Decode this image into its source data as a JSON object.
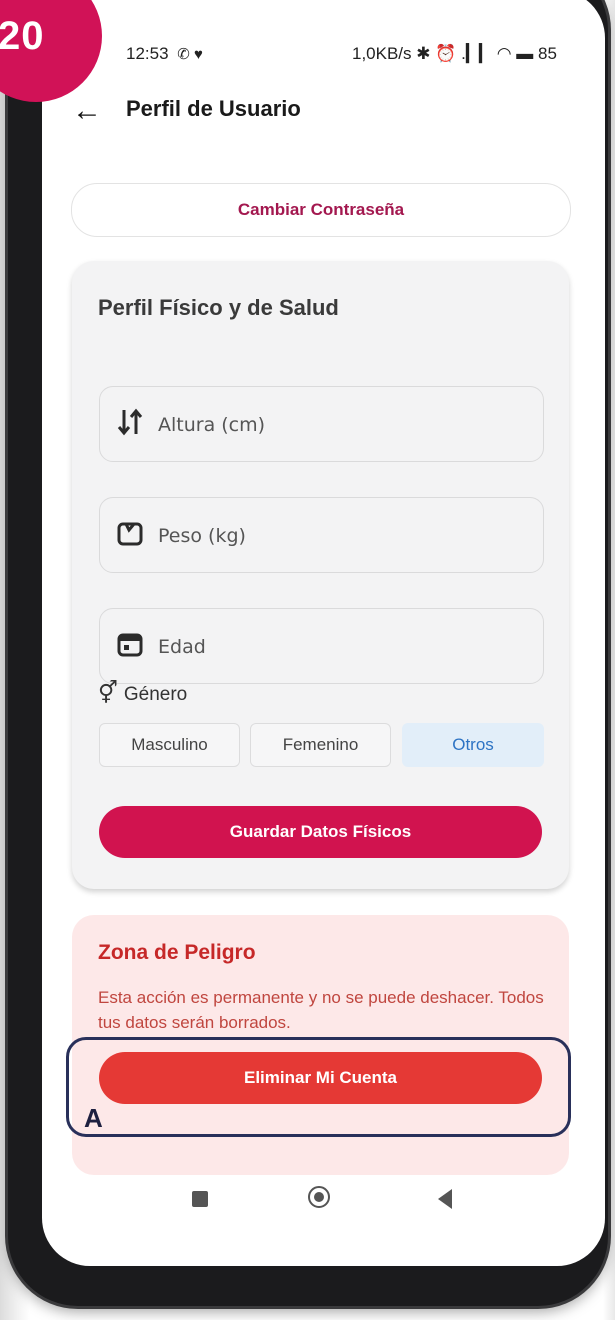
{
  "badge": {
    "number": "20"
  },
  "status_bar": {
    "time": "12:53",
    "left_icons": "✆ ♥",
    "right_text": "1,0KB/s ✱ ⏰ .▎▎ ◠ ▬ 85"
  },
  "header": {
    "back_icon": "arrow-left-icon",
    "title": "Perfil de Usuario"
  },
  "change_password": {
    "label": "Cambiar Contraseña"
  },
  "physical_profile": {
    "title": "Perfil Físico y de Salud",
    "fields": [
      {
        "icon": "height-arrows-icon",
        "placeholder": "Altura (cm)"
      },
      {
        "icon": "weight-icon",
        "placeholder": "Peso (kg)"
      },
      {
        "icon": "calendar-icon",
        "placeholder": "Edad"
      }
    ],
    "gender": {
      "label": "Género",
      "icon": "gender-icon",
      "options": [
        "Masculino",
        "Femenino",
        "Otros"
      ],
      "selected": "Otros"
    },
    "save_label": "Guardar Datos Físicos"
  },
  "danger_zone": {
    "title": "Zona de Peligro",
    "text": "Esta acción es permanente y no se puede deshacer. Todos tus datos serán borrados.",
    "delete_label": "Eliminar Mi Cuenta"
  },
  "annotation": {
    "label": "A"
  },
  "colors": {
    "accent": "#d1134f",
    "danger": "#e53935",
    "selected_option": "#2d73c4"
  }
}
